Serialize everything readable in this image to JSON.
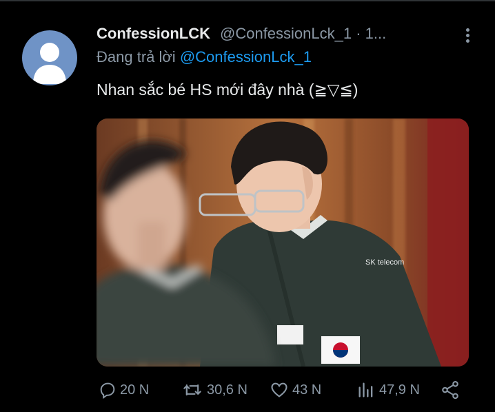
{
  "tweet": {
    "display_name": "ConfessionLCK",
    "handle_time": "@ConfessionLck_1 · 1...",
    "reply_prefix": "Đang trả lời",
    "reply_to": "@ConfessionLck_1",
    "text": "Nhan sắc bé HS mới đây nhà (≧▽≦)",
    "media_icon": "photo-player-jersey",
    "flag_icon": "south-korea-flag"
  },
  "actions": {
    "reply_count": "20 N",
    "retweet_count": "30,6 N",
    "like_count": "43 N",
    "views_count": "47,9 N"
  },
  "colors": {
    "background": "#000000",
    "text_primary": "#e7e9ea",
    "text_secondary": "#8b98a5",
    "link": "#1d9bf0",
    "avatar_bg": "#6f93c6"
  }
}
